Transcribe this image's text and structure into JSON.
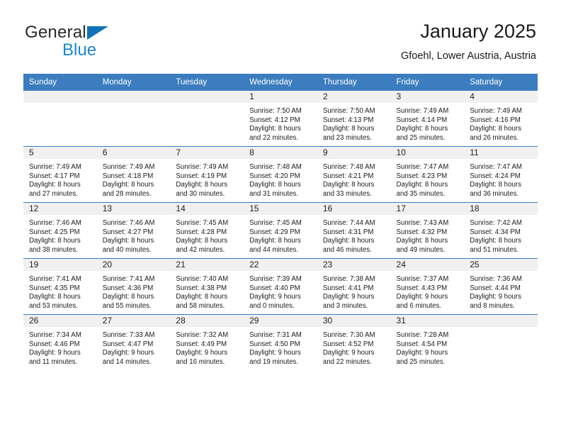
{
  "brand": {
    "name_top": "General",
    "name_bottom": "Blue",
    "accent_color": "#1b87d4",
    "triangle_color": "#1073b7"
  },
  "header": {
    "title": "January 2025",
    "subtitle": "Gfoehl, Lower Austria, Austria"
  },
  "theme": {
    "header_row_bg": "#3b7dbf",
    "header_row_text": "#ffffff",
    "daynum_band_bg": "#f0f0f0",
    "grid_line": "#3b7dbf"
  },
  "weekdays": [
    "Sunday",
    "Monday",
    "Tuesday",
    "Wednesday",
    "Thursday",
    "Friday",
    "Saturday"
  ],
  "labels": {
    "sunrise_prefix": "Sunrise:",
    "sunset_prefix": "Sunset:",
    "daylight_prefix": "Daylight:"
  },
  "weeks": [
    [
      {
        "day": "",
        "blank": true
      },
      {
        "day": "",
        "blank": true
      },
      {
        "day": "",
        "blank": true
      },
      {
        "day": "1",
        "sunrise": "Sunrise: 7:50 AM",
        "sunset": "Sunset: 4:12 PM",
        "daylight1": "Daylight: 8 hours",
        "daylight2": "and 22 minutes."
      },
      {
        "day": "2",
        "sunrise": "Sunrise: 7:50 AM",
        "sunset": "Sunset: 4:13 PM",
        "daylight1": "Daylight: 8 hours",
        "daylight2": "and 23 minutes."
      },
      {
        "day": "3",
        "sunrise": "Sunrise: 7:49 AM",
        "sunset": "Sunset: 4:14 PM",
        "daylight1": "Daylight: 8 hours",
        "daylight2": "and 25 minutes."
      },
      {
        "day": "4",
        "sunrise": "Sunrise: 7:49 AM",
        "sunset": "Sunset: 4:16 PM",
        "daylight1": "Daylight: 8 hours",
        "daylight2": "and 26 minutes."
      }
    ],
    [
      {
        "day": "5",
        "sunrise": "Sunrise: 7:49 AM",
        "sunset": "Sunset: 4:17 PM",
        "daylight1": "Daylight: 8 hours",
        "daylight2": "and 27 minutes."
      },
      {
        "day": "6",
        "sunrise": "Sunrise: 7:49 AM",
        "sunset": "Sunset: 4:18 PM",
        "daylight1": "Daylight: 8 hours",
        "daylight2": "and 28 minutes."
      },
      {
        "day": "7",
        "sunrise": "Sunrise: 7:49 AM",
        "sunset": "Sunset: 4:19 PM",
        "daylight1": "Daylight: 8 hours",
        "daylight2": "and 30 minutes."
      },
      {
        "day": "8",
        "sunrise": "Sunrise: 7:48 AM",
        "sunset": "Sunset: 4:20 PM",
        "daylight1": "Daylight: 8 hours",
        "daylight2": "and 31 minutes."
      },
      {
        "day": "9",
        "sunrise": "Sunrise: 7:48 AM",
        "sunset": "Sunset: 4:21 PM",
        "daylight1": "Daylight: 8 hours",
        "daylight2": "and 33 minutes."
      },
      {
        "day": "10",
        "sunrise": "Sunrise: 7:47 AM",
        "sunset": "Sunset: 4:23 PM",
        "daylight1": "Daylight: 8 hours",
        "daylight2": "and 35 minutes."
      },
      {
        "day": "11",
        "sunrise": "Sunrise: 7:47 AM",
        "sunset": "Sunset: 4:24 PM",
        "daylight1": "Daylight: 8 hours",
        "daylight2": "and 36 minutes."
      }
    ],
    [
      {
        "day": "12",
        "sunrise": "Sunrise: 7:46 AM",
        "sunset": "Sunset: 4:25 PM",
        "daylight1": "Daylight: 8 hours",
        "daylight2": "and 38 minutes."
      },
      {
        "day": "13",
        "sunrise": "Sunrise: 7:46 AM",
        "sunset": "Sunset: 4:27 PM",
        "daylight1": "Daylight: 8 hours",
        "daylight2": "and 40 minutes."
      },
      {
        "day": "14",
        "sunrise": "Sunrise: 7:45 AM",
        "sunset": "Sunset: 4:28 PM",
        "daylight1": "Daylight: 8 hours",
        "daylight2": "and 42 minutes."
      },
      {
        "day": "15",
        "sunrise": "Sunrise: 7:45 AM",
        "sunset": "Sunset: 4:29 PM",
        "daylight1": "Daylight: 8 hours",
        "daylight2": "and 44 minutes."
      },
      {
        "day": "16",
        "sunrise": "Sunrise: 7:44 AM",
        "sunset": "Sunset: 4:31 PM",
        "daylight1": "Daylight: 8 hours",
        "daylight2": "and 46 minutes."
      },
      {
        "day": "17",
        "sunrise": "Sunrise: 7:43 AM",
        "sunset": "Sunset: 4:32 PM",
        "daylight1": "Daylight: 8 hours",
        "daylight2": "and 49 minutes."
      },
      {
        "day": "18",
        "sunrise": "Sunrise: 7:42 AM",
        "sunset": "Sunset: 4:34 PM",
        "daylight1": "Daylight: 8 hours",
        "daylight2": "and 51 minutes."
      }
    ],
    [
      {
        "day": "19",
        "sunrise": "Sunrise: 7:41 AM",
        "sunset": "Sunset: 4:35 PM",
        "daylight1": "Daylight: 8 hours",
        "daylight2": "and 53 minutes."
      },
      {
        "day": "20",
        "sunrise": "Sunrise: 7:41 AM",
        "sunset": "Sunset: 4:36 PM",
        "daylight1": "Daylight: 8 hours",
        "daylight2": "and 55 minutes."
      },
      {
        "day": "21",
        "sunrise": "Sunrise: 7:40 AM",
        "sunset": "Sunset: 4:38 PM",
        "daylight1": "Daylight: 8 hours",
        "daylight2": "and 58 minutes."
      },
      {
        "day": "22",
        "sunrise": "Sunrise: 7:39 AM",
        "sunset": "Sunset: 4:40 PM",
        "daylight1": "Daylight: 9 hours",
        "daylight2": "and 0 minutes."
      },
      {
        "day": "23",
        "sunrise": "Sunrise: 7:38 AM",
        "sunset": "Sunset: 4:41 PM",
        "daylight1": "Daylight: 9 hours",
        "daylight2": "and 3 minutes."
      },
      {
        "day": "24",
        "sunrise": "Sunrise: 7:37 AM",
        "sunset": "Sunset: 4:43 PM",
        "daylight1": "Daylight: 9 hours",
        "daylight2": "and 6 minutes."
      },
      {
        "day": "25",
        "sunrise": "Sunrise: 7:36 AM",
        "sunset": "Sunset: 4:44 PM",
        "daylight1": "Daylight: 9 hours",
        "daylight2": "and 8 minutes."
      }
    ],
    [
      {
        "day": "26",
        "sunrise": "Sunrise: 7:34 AM",
        "sunset": "Sunset: 4:46 PM",
        "daylight1": "Daylight: 9 hours",
        "daylight2": "and 11 minutes."
      },
      {
        "day": "27",
        "sunrise": "Sunrise: 7:33 AM",
        "sunset": "Sunset: 4:47 PM",
        "daylight1": "Daylight: 9 hours",
        "daylight2": "and 14 minutes."
      },
      {
        "day": "28",
        "sunrise": "Sunrise: 7:32 AM",
        "sunset": "Sunset: 4:49 PM",
        "daylight1": "Daylight: 9 hours",
        "daylight2": "and 16 minutes."
      },
      {
        "day": "29",
        "sunrise": "Sunrise: 7:31 AM",
        "sunset": "Sunset: 4:50 PM",
        "daylight1": "Daylight: 9 hours",
        "daylight2": "and 19 minutes."
      },
      {
        "day": "30",
        "sunrise": "Sunrise: 7:30 AM",
        "sunset": "Sunset: 4:52 PM",
        "daylight1": "Daylight: 9 hours",
        "daylight2": "and 22 minutes."
      },
      {
        "day": "31",
        "sunrise": "Sunrise: 7:28 AM",
        "sunset": "Sunset: 4:54 PM",
        "daylight1": "Daylight: 9 hours",
        "daylight2": "and 25 minutes."
      },
      {
        "day": "",
        "blank": true
      }
    ]
  ]
}
